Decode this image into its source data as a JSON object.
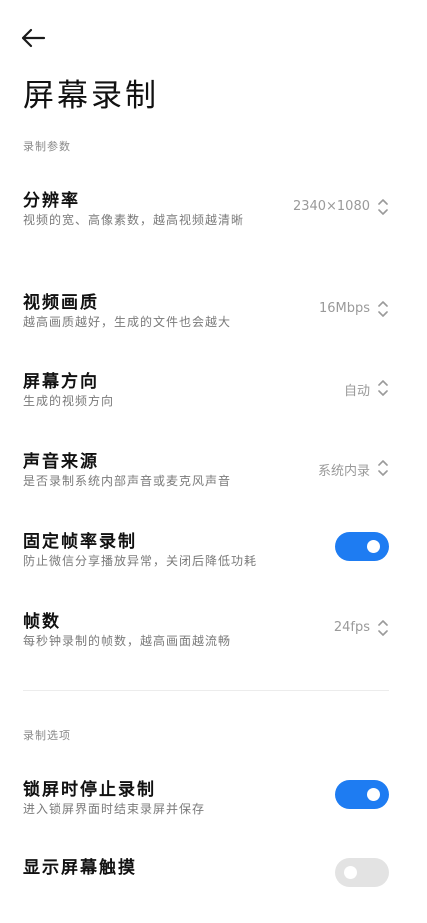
{
  "header": {
    "title": "屏幕录制"
  },
  "sections": {
    "params": {
      "label": "录制参数",
      "items": [
        {
          "title": "分辨率",
          "subtitle": "视频的宽、高像素数，越高视频越清晰",
          "value": "2340×1080"
        },
        {
          "title": "视频画质",
          "subtitle": "越高画质越好，生成的文件也会越大",
          "value": "16Mbps"
        },
        {
          "title": "屏幕方向",
          "subtitle": "生成的视频方向",
          "value": "自动"
        },
        {
          "title": "声音来源",
          "subtitle": "是否录制系统内部声音或麦克风声音",
          "value": "系统内录"
        },
        {
          "title": "固定帧率录制",
          "subtitle": "防止微信分享播放异常，关闭后降低功耗",
          "toggle": true
        },
        {
          "title": "帧数",
          "subtitle": "每秒钟录制的帧数，越高画面越流畅",
          "value": "24fps"
        }
      ]
    },
    "options": {
      "label": "录制选项",
      "items": [
        {
          "title": "锁屏时停止录制",
          "subtitle": "进入锁屏界面时结束录屏并保存",
          "toggle": true
        },
        {
          "title": "显示屏幕触摸",
          "subtitle": "",
          "toggle": false
        }
      ]
    }
  },
  "colors": {
    "accent": "#1e7cf2",
    "toggle_off": "#e3e3e3",
    "section_label": "#8a8a8a",
    "subtitle": "#7a7a7a"
  },
  "icons": {
    "back": "back-arrow-icon",
    "value_selector": "chevron-up-down-icon"
  }
}
